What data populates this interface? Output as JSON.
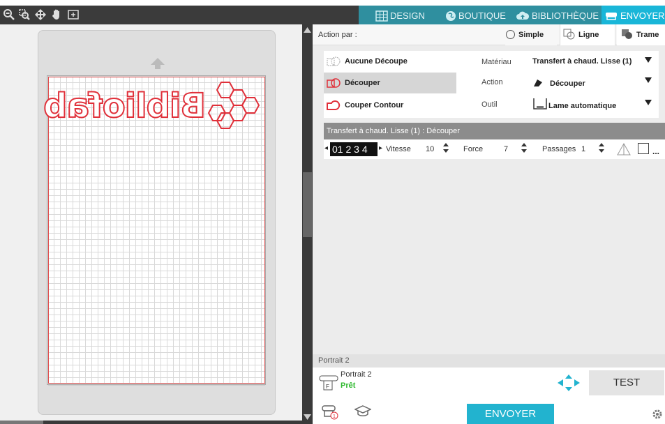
{
  "toolbar": {
    "icons": [
      "zoom-out-icon",
      "zoom-selection-icon",
      "move-arrows-icon",
      "pan-hand-icon",
      "fit-to-page-icon"
    ]
  },
  "tabs": [
    {
      "label": "DESIGN",
      "icon": "grid-icon"
    },
    {
      "label": "BOUTIQUE",
      "icon": "store-icon"
    },
    {
      "label": "BIBLIOTHÈQUE",
      "icon": "cloud-icon"
    },
    {
      "label": "ENVOYER",
      "icon": "cutter-icon",
      "active": true
    }
  ],
  "canvas": {
    "design_text": "Bibliofab"
  },
  "action_bar": {
    "label": "Action par :",
    "options": [
      "Simple",
      "Ligne",
      "Trame"
    ]
  },
  "cut_options": [
    "Aucune Découpe",
    "Découper",
    "Couper Contour"
  ],
  "params": {
    "material_label": "Matériau",
    "material_value": "Transfert à chaud. Lisse (1)",
    "action_label": "Action",
    "action_value": "Découper",
    "tool_label": "Outil",
    "tool_value": "Lame automatique"
  },
  "settings": {
    "header": "Transfert à chaud. Lisse (1) : Découper",
    "blade_digits": "01 2 3 4",
    "speed_label": "Vitesse",
    "speed_value": "10",
    "force_label": "Force",
    "force_value": "7",
    "passes_label": "Passages",
    "passes_value": "1",
    "more": "..."
  },
  "device": {
    "section_label": "Portrait 2",
    "name": "Portrait 2",
    "status": "Prêt",
    "test_label": "TEST"
  },
  "bottom": {
    "send_label": "ENVOYER"
  },
  "colors": {
    "accent": "#22b3cf",
    "tabbar": "#2f8f9f",
    "design_red": "#e0303a",
    "status_green": "#2db82d"
  }
}
